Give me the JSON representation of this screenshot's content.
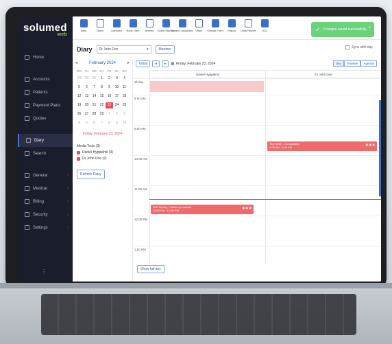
{
  "app": {
    "logo_text": "solumed",
    "logo_sub": "web"
  },
  "sidebar": {
    "items": [
      {
        "label": "Home",
        "icon": "home-icon"
      },
      {
        "label": "Accounts",
        "icon": "accounts-icon"
      },
      {
        "label": "Patients",
        "icon": "patients-icon"
      },
      {
        "label": "Payment Plans",
        "icon": "payment-icon"
      },
      {
        "label": "Quotes",
        "icon": "quotes-icon"
      },
      {
        "label": "Diary",
        "icon": "diary-icon",
        "active": true
      },
      {
        "label": "Search",
        "icon": "search-icon"
      },
      {
        "label": "General",
        "icon": "general-icon",
        "chevron": true
      },
      {
        "label": "Medical",
        "icon": "medical-icon",
        "chevron": true
      },
      {
        "label": "Billing",
        "icon": "billing-icon",
        "chevron": true
      },
      {
        "label": "Security",
        "icon": "security-icon",
        "chevron": true
      },
      {
        "label": "Settings",
        "icon": "settings-icon",
        "chevron": true
      }
    ]
  },
  "toolbar": {
    "tools": [
      {
        "label": "New",
        "icon": "new-file-icon"
      },
      {
        "label": "Open",
        "icon": "folder-icon"
      },
      {
        "label": "Overview",
        "icon": "overview-icon"
      },
      {
        "label": "Book Time",
        "icon": "book-time-icon"
      },
      {
        "label": "Arrived",
        "icon": "arrived-icon"
      },
      {
        "label": "Exam Started",
        "icon": "exam-started-icon"
      },
      {
        "label": "Exam Completed",
        "icon": "stethoscope-icon"
      },
      {
        "label": "Vitals",
        "icon": "heart-icon"
      },
      {
        "label": "Clinical Form",
        "icon": "clinical-form-icon"
      },
      {
        "label": "Report",
        "icon": "report-icon"
      },
      {
        "label": "Units Report",
        "icon": "units-report-icon"
      },
      {
        "label": "ICD",
        "icon": "icd-icon"
      }
    ],
    "toast": "Changes saved successfully"
  },
  "diary": {
    "title": "Diary",
    "doctor_select": "Dr John Doe",
    "member_button": "Member",
    "sync_label": "Sync with day"
  },
  "mini_calendar": {
    "month_label": "February 2024",
    "prev": "◂",
    "next": "▸",
    "dows": [
      "MO",
      "TU",
      "WE",
      "TH",
      "FR",
      "SA",
      "SU"
    ],
    "weeks": [
      [
        "29",
        "30",
        "31",
        "1",
        "2",
        "3",
        "4"
      ],
      [
        "5",
        "6",
        "7",
        "8",
        "9",
        "10",
        "11"
      ],
      [
        "12",
        "13",
        "14",
        "15",
        "16",
        "17",
        "18"
      ],
      [
        "19",
        "20",
        "21",
        "22",
        "23",
        "24",
        "25"
      ],
      [
        "26",
        "27",
        "28",
        "29",
        "1",
        "2",
        "3"
      ],
      [
        "4",
        "5",
        "6",
        "7",
        "8",
        "9",
        "10"
      ]
    ],
    "selected_day": "23",
    "today_label": "Friday, February 23, 2024",
    "legend_title": "Media Toolx (3)",
    "legend": [
      "Daniel Hyppelmil (3)",
      "Dr John Doe (2)"
    ],
    "refresh_button": "Refresh Diary"
  },
  "main": {
    "today_button": "Today",
    "prev": "◂",
    "next": "▸",
    "date_label": "Friday, February 23, 2024",
    "views": [
      "Day",
      "Timeline",
      "Agenda"
    ],
    "columns": [
      "Daniel Hyppelmil",
      "Dr John Doe"
    ],
    "hours": [
      "all-day",
      "8:00 AM",
      "9:00 AM",
      "10:00 AM",
      "11:00 AM",
      "12:00 PM",
      "1:00 PM"
    ],
    "events": [
      {
        "title": "Test Smith - Consultation",
        "time": "9:00 AM - 9:30 AM"
      },
      {
        "title": "Test Testing - Follow up consult",
        "time": "12:00 PM - 12:30 PM"
      }
    ],
    "show_full_day": "Show full day"
  },
  "colors": {
    "sidebar_bg": "#1a1d2b",
    "accent_blue": "#3b6fc6",
    "event_red": "#ef6b6b",
    "allday_pink": "#f8c9c9",
    "toast_green": "#6ad27b"
  }
}
